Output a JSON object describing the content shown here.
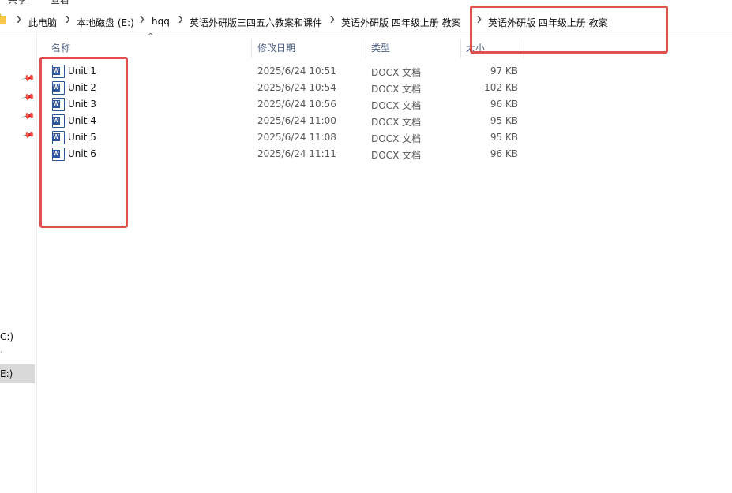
{
  "ribbon": {
    "tab_share": "共享",
    "tab_view": "查看"
  },
  "breadcrumb": [
    "此电脑",
    "本地磁盘 (E:)",
    "hqq",
    "英语外研版三四五六教案和课件",
    "英语外研版  四年级上册  教案",
    "英语外研版  四年级上册  教案"
  ],
  "nav": {
    "drive_c": "C:)",
    "drive_e": "E:)"
  },
  "columns": {
    "name": "名称",
    "modified": "修改日期",
    "type": "类型",
    "size": "大小"
  },
  "files": [
    {
      "name": "Unit 1",
      "modified": "2025/6/24 10:51",
      "type": "DOCX 文档",
      "size": "97 KB"
    },
    {
      "name": "Unit 2",
      "modified": "2025/6/24 10:54",
      "type": "DOCX 文档",
      "size": "102 KB"
    },
    {
      "name": "Unit 3",
      "modified": "2025/6/24 10:56",
      "type": "DOCX 文档",
      "size": "96 KB"
    },
    {
      "name": "Unit 4",
      "modified": "2025/6/24 11:00",
      "type": "DOCX 文档",
      "size": "95 KB"
    },
    {
      "name": "Unit 5",
      "modified": "2025/6/24 11:08",
      "type": "DOCX 文档",
      "size": "95 KB"
    },
    {
      "name": "Unit 6",
      "modified": "2025/6/24 11:11",
      "type": "DOCX 文档",
      "size": "96 KB"
    }
  ],
  "icons": {
    "file": "word-doc-icon",
    "pin": "pin-icon",
    "folder": "folder-icon",
    "separator": "chevron-right-icon"
  },
  "colors": {
    "annotation": "#e0504f",
    "word_blue": "#2b579a",
    "selected_nav": "#d9d9d9"
  }
}
